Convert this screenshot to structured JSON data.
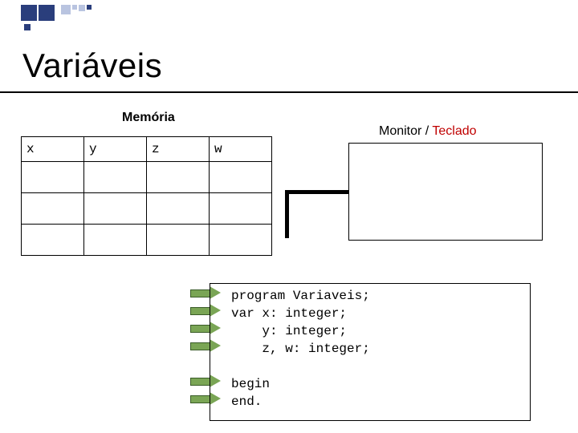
{
  "title": "Variáveis",
  "memory_label": "Memória",
  "monitor_label_plain": "Monitor / ",
  "monitor_label_red": "Teclado",
  "memory_headers": [
    "x",
    "y",
    "z",
    "w"
  ],
  "code": {
    "l1": "program Variaveis;",
    "l2": "var x: integer;",
    "l3": "    y: integer;",
    "l4": "    z, w: integer;",
    "l5": "",
    "l6": "begin",
    "l7": "end."
  },
  "arrow_targets": [
    "l1",
    "l2",
    "l3",
    "l4",
    "l6",
    "l7"
  ]
}
